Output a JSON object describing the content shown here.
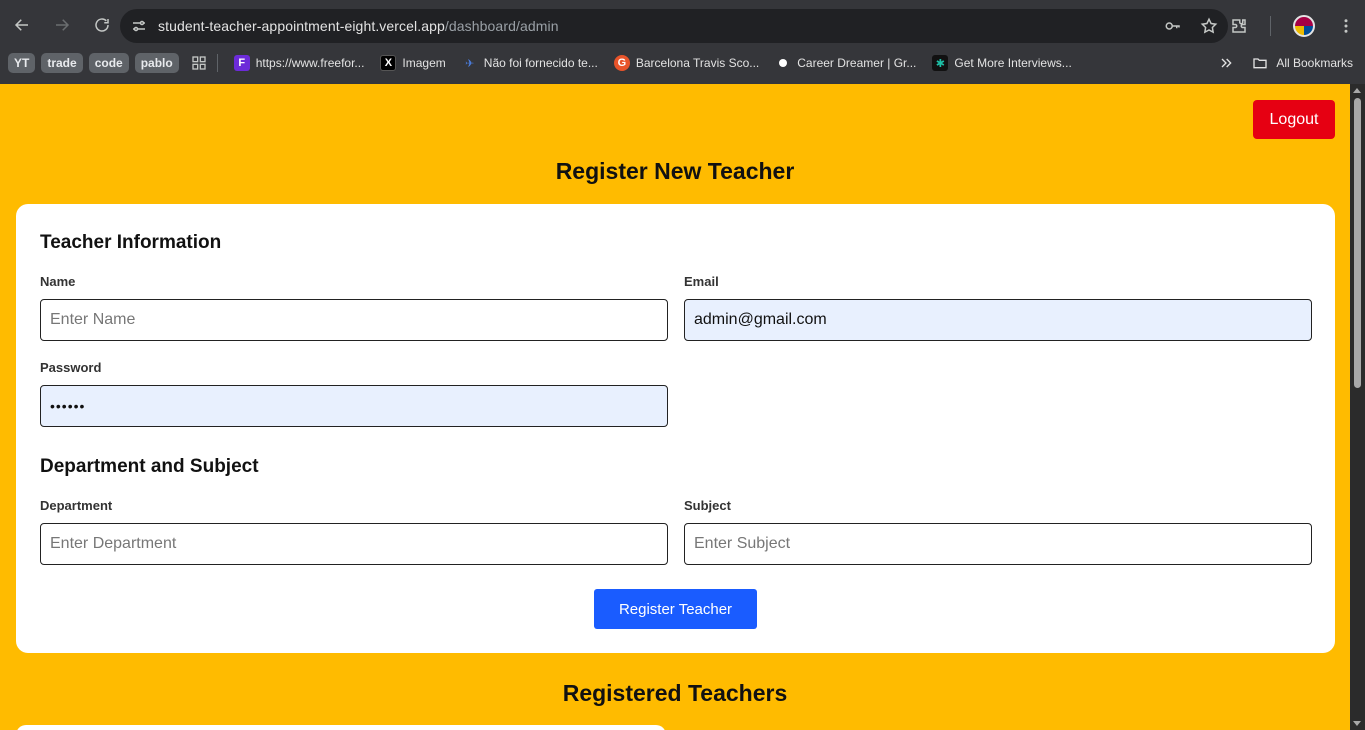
{
  "browser": {
    "url_main": "student-teacher-appointment-eight.vercel.app",
    "url_path": "/dashboard/admin",
    "bookmarks": {
      "chips": [
        "YT",
        "trade",
        "code",
        "pablo"
      ],
      "items": [
        {
          "label": "https://www.freefor...",
          "icon": "freeform-icon",
          "color": "#6c2bd9"
        },
        {
          "label": "Imagem",
          "icon": "x-icon",
          "color": "#000000"
        },
        {
          "label": "Não foi fornecido te...",
          "icon": "plane-icon",
          "color": "#1a3a8f"
        },
        {
          "label": "Barcelona Travis Sco...",
          "icon": "genius-icon",
          "color": "#e8542a"
        },
        {
          "label": "Career Dreamer | Gr...",
          "icon": "dot-icon",
          "color": "#ffffff"
        },
        {
          "label": "Get More Interviews...",
          "icon": "star-icon",
          "color": "#1dbfa6"
        }
      ],
      "all_bookmarks": "All Bookmarks"
    }
  },
  "header": {
    "logout_label": "Logout",
    "title": "Register New Teacher"
  },
  "form": {
    "teacher_info_title": "Teacher Information",
    "name_label": "Name",
    "name_placeholder": "Enter Name",
    "email_label": "Email",
    "email_value": "admin@gmail.com",
    "password_label": "Password",
    "password_value": "123456",
    "dept_subject_title": "Department and Subject",
    "department_label": "Department",
    "department_placeholder": "Enter Department",
    "subject_label": "Subject",
    "subject_placeholder": "Enter Subject",
    "submit_label": "Register Teacher"
  },
  "list": {
    "title": "Registered Teachers"
  },
  "colors": {
    "page_bg": "#ffbb00",
    "logout": "#e60012",
    "primary": "#1a5cff",
    "autofill": "#e8f0fe"
  }
}
